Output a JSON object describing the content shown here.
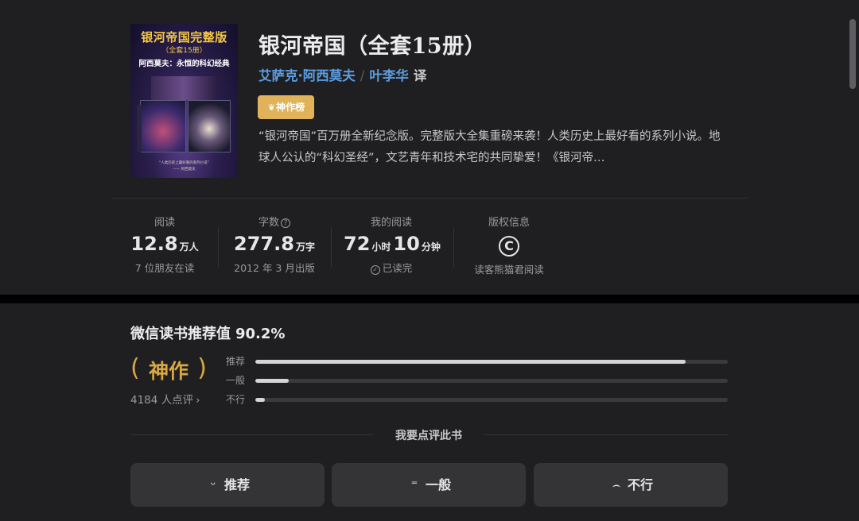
{
  "book": {
    "title": "银河帝国（全套15册）",
    "author": "艾萨克·阿西莫夫",
    "separator": "/",
    "translator": "叶李华",
    "translator_suffix": "译",
    "badge": "神作榜",
    "description": "“银河帝国”百万册全新纪念版。完整版大全集重磅来袭！人类历史上最好看的系列小说。地球人公认的“科幻圣经”，文艺青年和技术宅的共同挚爱！《银河帝…"
  },
  "cover": {
    "title": "银河帝国完整版",
    "subtitle": "（全套15册）",
    "author_line": "阿西莫夫：永恒的科幻经典"
  },
  "stats": {
    "reads": {
      "label": "阅读",
      "value": "12.8",
      "unit": "万人",
      "sub": "7 位朋友在读"
    },
    "words": {
      "label": "字数",
      "value": "277.8",
      "unit": "万字",
      "sub": "2012 年 3 月出版"
    },
    "my_reading": {
      "label": "我的阅读",
      "hours": "72",
      "hours_unit": "小时",
      "minutes": "10",
      "minutes_unit": "分钟",
      "sub": "已读完"
    },
    "copyright": {
      "label": "版权信息",
      "icon_text": "C",
      "sub": "读客熊猫君阅读"
    }
  },
  "rating": {
    "title": "微信读书推荐值",
    "percent": "90.2%",
    "badge_text": "神作",
    "count": "4184 人点评",
    "chevron": "›",
    "bars": [
      {
        "label": "推荐",
        "fraction": 0.91
      },
      {
        "label": "一般",
        "fraction": 0.07
      },
      {
        "label": "不行",
        "fraction": 0.02
      }
    ],
    "review_prompt": "我要点评此书",
    "buttons": {
      "recommend": "推荐",
      "average": "一般",
      "bad": "不行"
    }
  },
  "colors": {
    "accent_gold": "#d9a843",
    "badge_gold": "#e0b25a",
    "link_blue": "#5a9de0",
    "background": "#1f1f21"
  }
}
